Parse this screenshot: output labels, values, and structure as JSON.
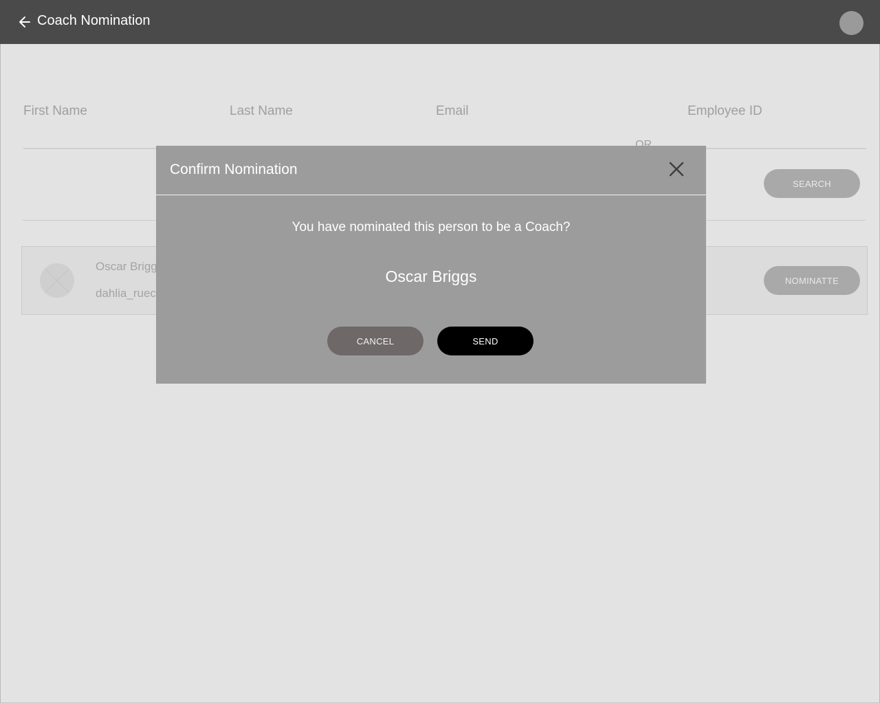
{
  "header": {
    "title": "Coach Nomination",
    "back_icon": "arrow-left-icon",
    "avatar_icon": "user-avatar"
  },
  "search_form": {
    "first_name_label": "First Name",
    "last_name_label": "Last Name",
    "email_label": "Email",
    "or_label": "OR",
    "employee_id_label": "Employee ID",
    "search_button": "SEARCH"
  },
  "result": {
    "name": "Oscar Briggs",
    "email": "dahlia_rueck",
    "nominate_button": "NOMINATTE"
  },
  "modal": {
    "title": "Confirm Nomination",
    "message": "You have nominated this person to be a Coach?",
    "nominee_name": "Oscar Briggs",
    "cancel_button": "CANCEL",
    "send_button": "SEND",
    "close_icon": "close-icon"
  },
  "colors": {
    "app_bar": "#4a4a4a",
    "background": "#e3e3e3",
    "modal": "#9c9c9c",
    "send_button": "#000000",
    "cancel_button": "#6e6868"
  }
}
